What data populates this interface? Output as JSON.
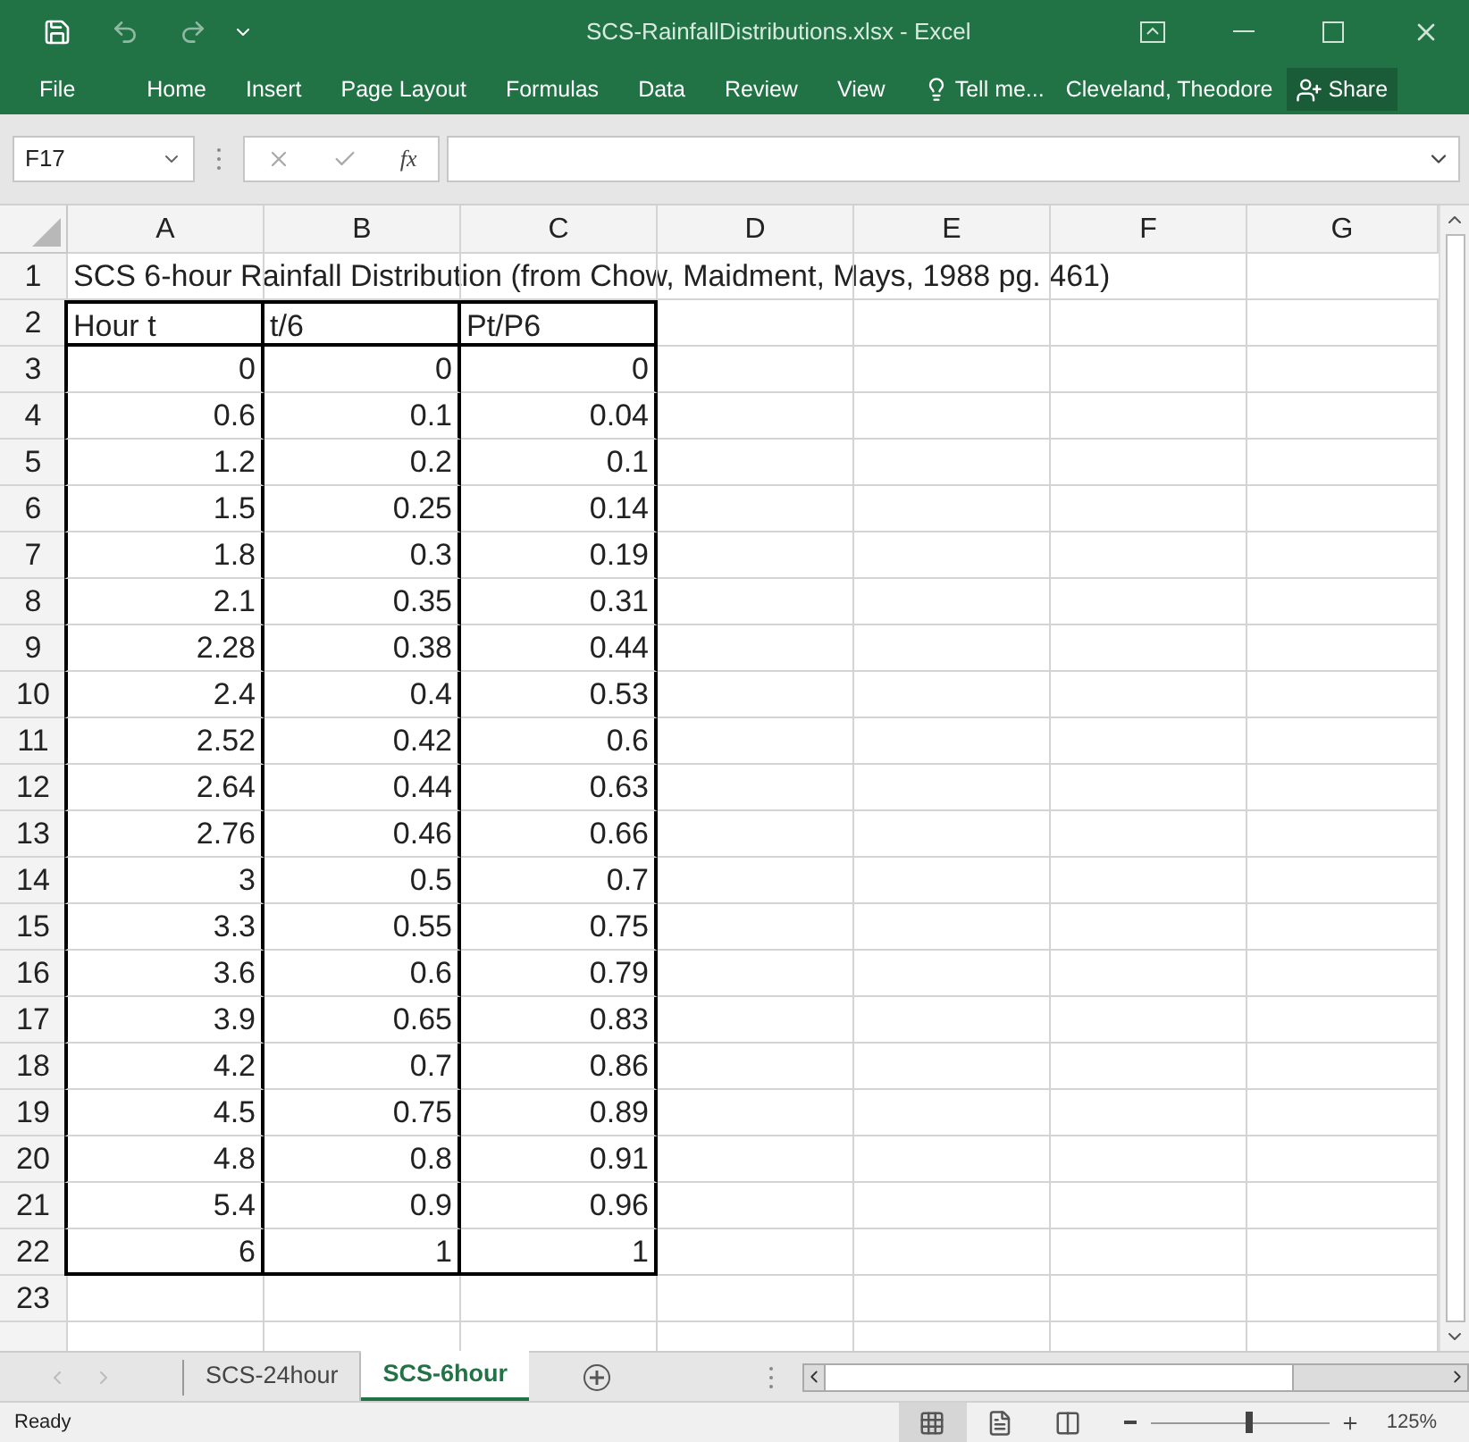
{
  "window": {
    "title": "SCS-RainfallDistributions.xlsx - Excel"
  },
  "ribbon": {
    "tabs": [
      "File",
      "Home",
      "Insert",
      "Page Layout",
      "Formulas",
      "Data",
      "Review",
      "View"
    ],
    "tell_me": "Tell me...",
    "user": "Cleveland, Theodore",
    "share": "Share"
  },
  "name_box": "F17",
  "formula_bar": {
    "fx": "fx"
  },
  "columns": [
    "A",
    "B",
    "C",
    "D",
    "E",
    "F",
    "G"
  ],
  "rows": [
    {
      "number": "1",
      "kind": "title",
      "cells": [
        "SCS 6-hour Rainfall Distribution (from Chow, Maidment, Mays, 1988 pg. 461)"
      ]
    },
    {
      "number": "2",
      "kind": "header",
      "cells": [
        "Hour t",
        "t/6",
        "Pt/P6"
      ]
    },
    {
      "number": "3",
      "kind": "data",
      "cells": [
        "0",
        "0",
        "0"
      ]
    },
    {
      "number": "4",
      "kind": "data",
      "cells": [
        "0.6",
        "0.1",
        "0.04"
      ]
    },
    {
      "number": "5",
      "kind": "data",
      "cells": [
        "1.2",
        "0.2",
        "0.1"
      ]
    },
    {
      "number": "6",
      "kind": "data",
      "cells": [
        "1.5",
        "0.25",
        "0.14"
      ]
    },
    {
      "number": "7",
      "kind": "data",
      "cells": [
        "1.8",
        "0.3",
        "0.19"
      ]
    },
    {
      "number": "8",
      "kind": "data",
      "cells": [
        "2.1",
        "0.35",
        "0.31"
      ]
    },
    {
      "number": "9",
      "kind": "data",
      "cells": [
        "2.28",
        "0.38",
        "0.44"
      ]
    },
    {
      "number": "10",
      "kind": "data",
      "cells": [
        "2.4",
        "0.4",
        "0.53"
      ]
    },
    {
      "number": "11",
      "kind": "data",
      "cells": [
        "2.52",
        "0.42",
        "0.6"
      ]
    },
    {
      "number": "12",
      "kind": "data",
      "cells": [
        "2.64",
        "0.44",
        "0.63"
      ]
    },
    {
      "number": "13",
      "kind": "data",
      "cells": [
        "2.76",
        "0.46",
        "0.66"
      ]
    },
    {
      "number": "14",
      "kind": "data",
      "cells": [
        "3",
        "0.5",
        "0.7"
      ]
    },
    {
      "number": "15",
      "kind": "data",
      "cells": [
        "3.3",
        "0.55",
        "0.75"
      ]
    },
    {
      "number": "16",
      "kind": "data",
      "cells": [
        "3.6",
        "0.6",
        "0.79"
      ]
    },
    {
      "number": "17",
      "kind": "data",
      "cells": [
        "3.9",
        "0.65",
        "0.83"
      ]
    },
    {
      "number": "18",
      "kind": "data",
      "cells": [
        "4.2",
        "0.7",
        "0.86"
      ]
    },
    {
      "number": "19",
      "kind": "data",
      "cells": [
        "4.5",
        "0.75",
        "0.89"
      ]
    },
    {
      "number": "20",
      "kind": "data",
      "cells": [
        "4.8",
        "0.8",
        "0.91"
      ]
    },
    {
      "number": "21",
      "kind": "data",
      "cells": [
        "5.4",
        "0.9",
        "0.96"
      ]
    },
    {
      "number": "22",
      "kind": "last",
      "cells": [
        "6",
        "1",
        "1"
      ]
    },
    {
      "number": "23",
      "kind": "empty",
      "cells": []
    }
  ],
  "sheet_tabs": [
    {
      "label": "SCS-24hour",
      "selected": false
    },
    {
      "label": "SCS-6hour",
      "selected": true
    }
  ],
  "status_bar": {
    "text": "Ready",
    "views": [
      {
        "kind": "normal",
        "selected": true
      },
      {
        "kind": "page-layout",
        "selected": false
      },
      {
        "kind": "page-break",
        "selected": false
      }
    ],
    "zoom": {
      "level": 0.55,
      "reading": "125%"
    }
  }
}
